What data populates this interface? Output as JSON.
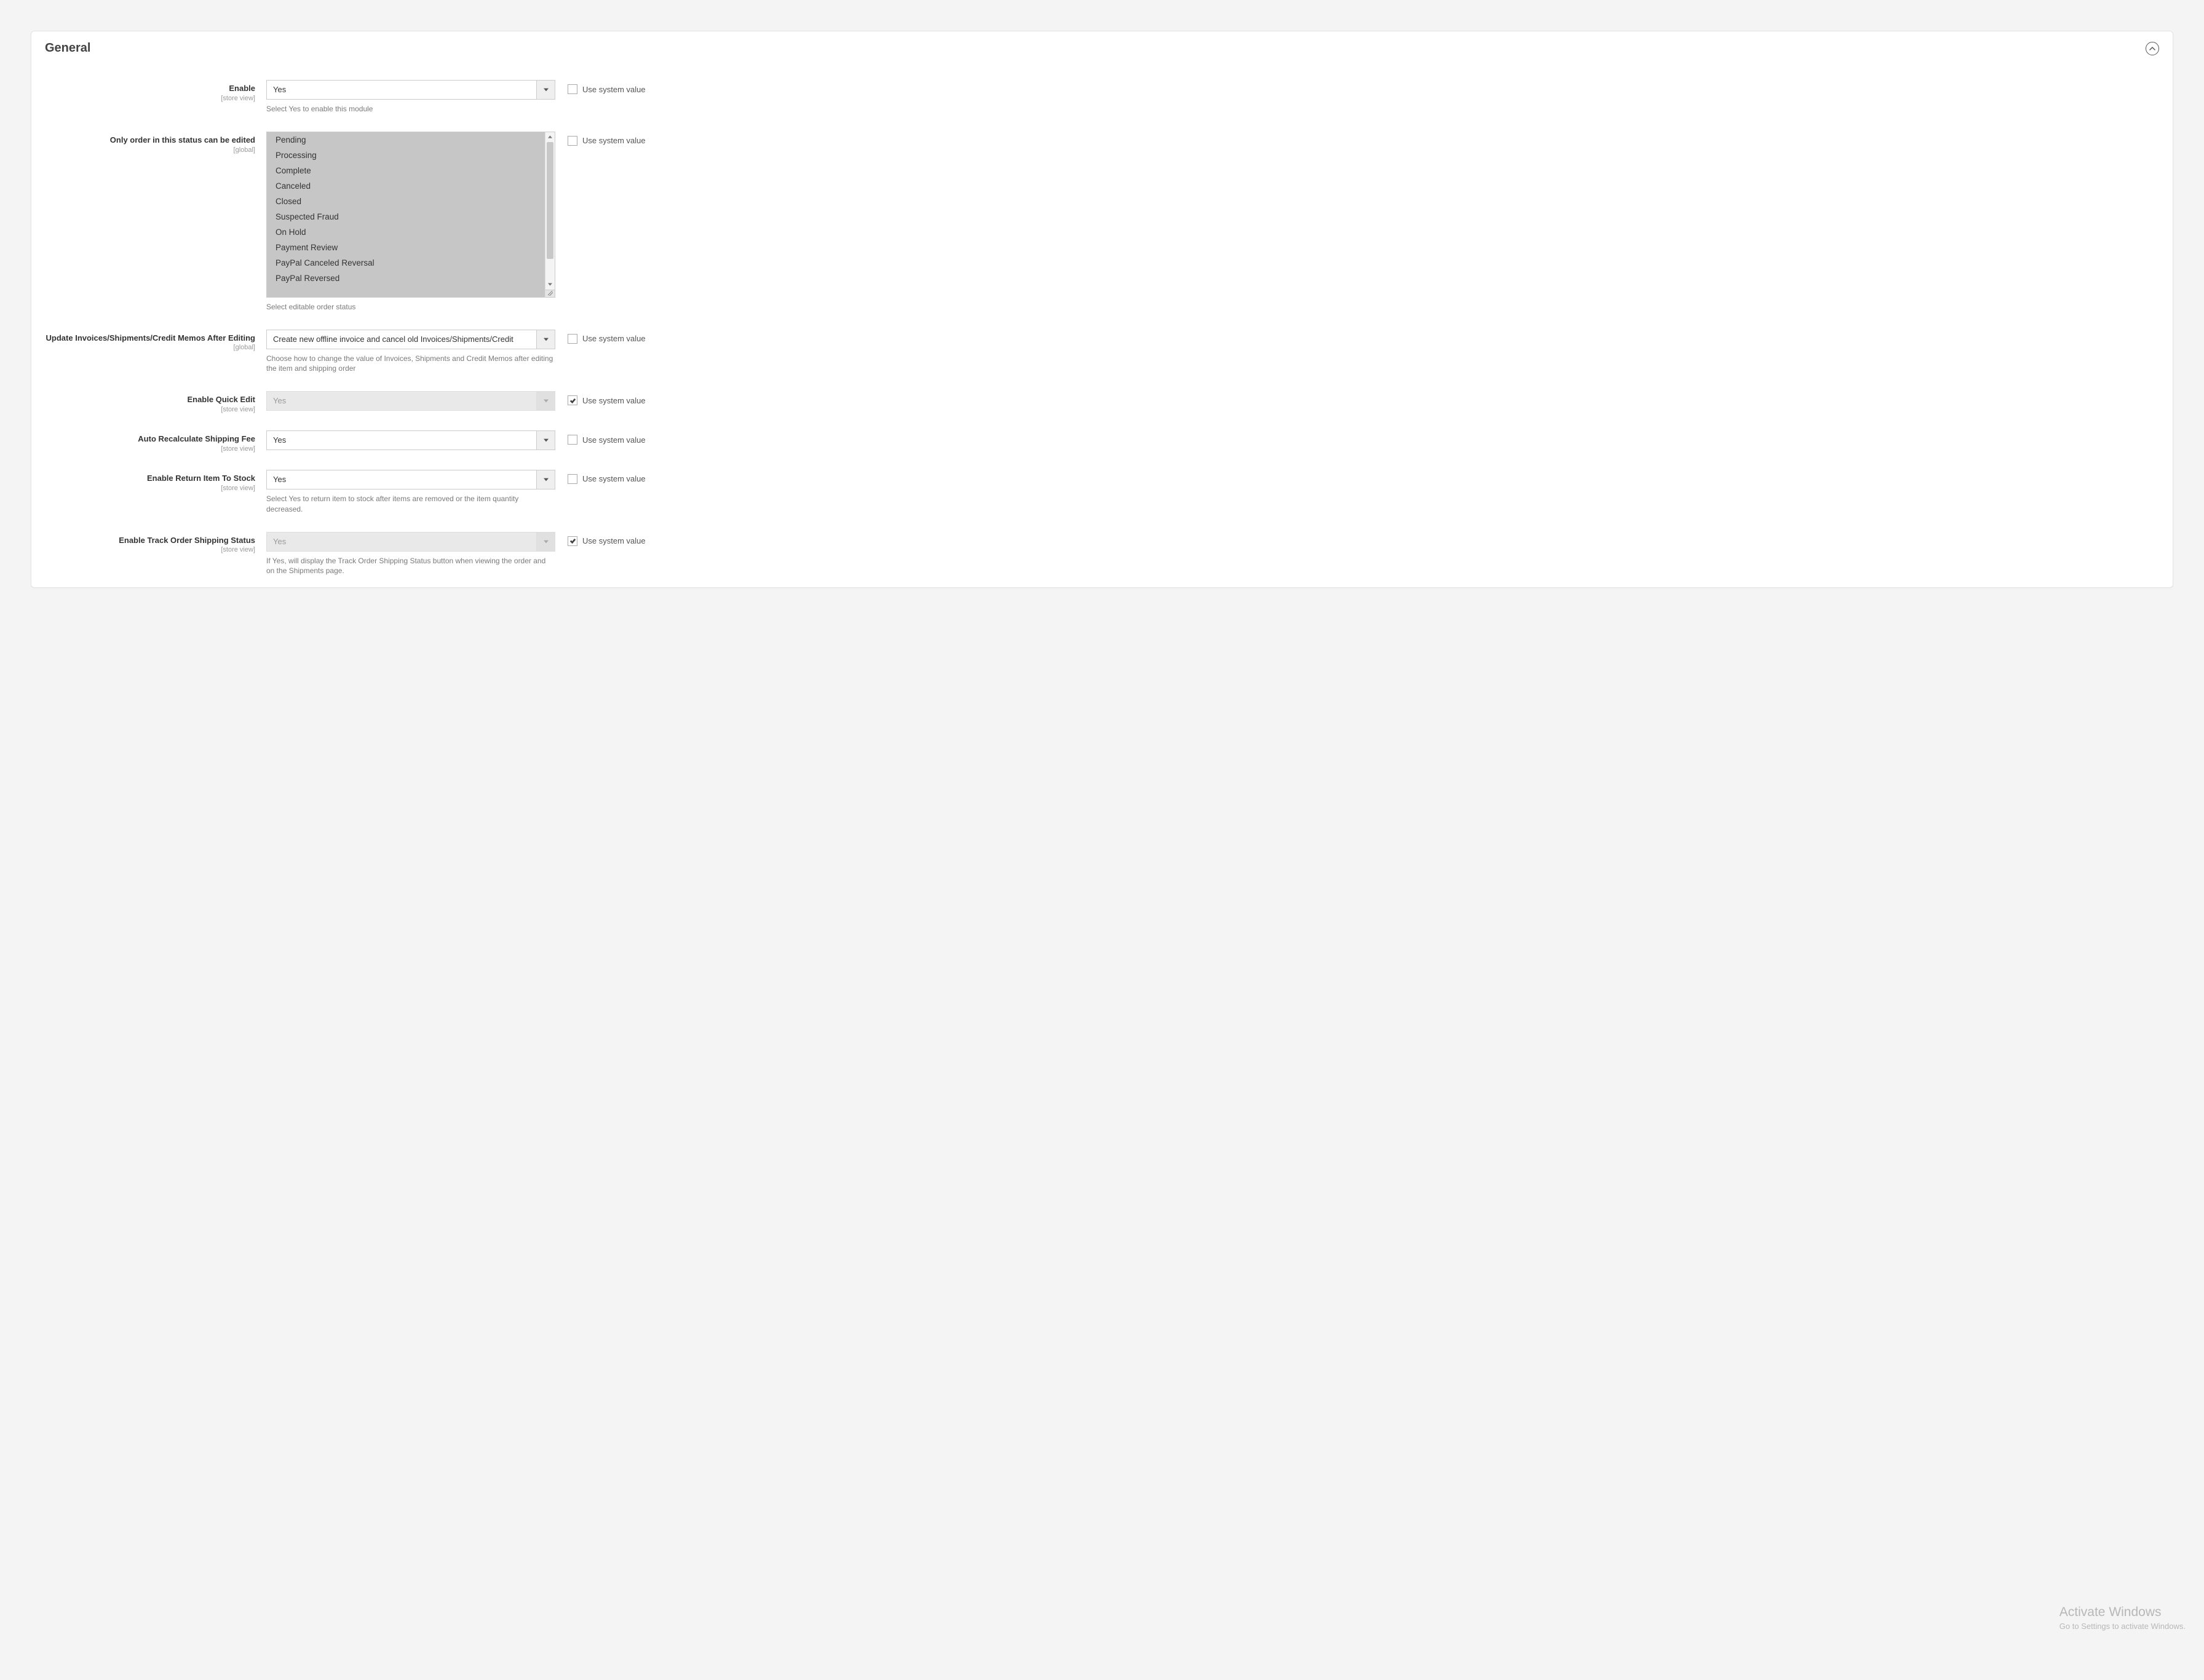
{
  "panel": {
    "title": "General"
  },
  "system_value_label": "Use system value",
  "fields": {
    "enable": {
      "label": "Enable",
      "scope": "[store view]",
      "value": "Yes",
      "note": "Select Yes to enable this module",
      "use_system": false
    },
    "order_status": {
      "label": "Only order in this status can be edited",
      "scope": "[global]",
      "options": [
        "Pending",
        "Processing",
        "Complete",
        "Canceled",
        "Closed",
        "Suspected Fraud",
        "On Hold",
        "Payment Review",
        "PayPal Canceled Reversal",
        "PayPal Reversed"
      ],
      "note": "Select editable order status",
      "use_system": false
    },
    "update_invoices": {
      "label": "Update Invoices/Shipments/Credit Memos After Editing",
      "scope": "[global]",
      "value": "Create new offline invoice and cancel old Invoices/Shipments/Credit",
      "note": "Choose how to change the value of Invoices, Shipments and Credit Memos after editing the item and shipping order",
      "use_system": false
    },
    "quick_edit": {
      "label": "Enable Quick Edit",
      "scope": "[store view]",
      "value": "Yes",
      "use_system": true
    },
    "auto_recalc": {
      "label": "Auto Recalculate Shipping Fee",
      "scope": "[store view]",
      "value": "Yes",
      "use_system": false
    },
    "return_stock": {
      "label": "Enable Return Item To Stock",
      "scope": "[store view]",
      "value": "Yes",
      "note": "Select Yes to return item to stock after items are removed or the item quantity decreased.",
      "use_system": false
    },
    "track_shipping": {
      "label": "Enable Track Order Shipping Status",
      "scope": "[store view]",
      "value": "Yes",
      "note": "If Yes, will display the Track Order Shipping Status button when viewing the order and on the Shipments page.",
      "use_system": true
    }
  },
  "watermark": {
    "title": "Activate Windows",
    "sub": "Go to Settings to activate Windows."
  }
}
